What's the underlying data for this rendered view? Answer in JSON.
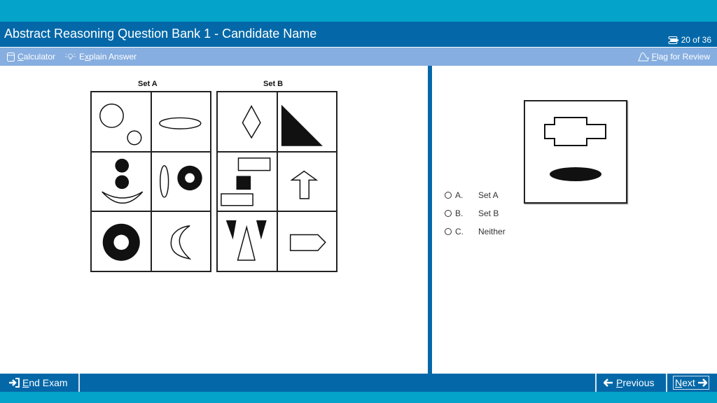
{
  "header": {
    "title": "Abstract Reasoning Question Bank 1 - Candidate Name",
    "counter": "20 of 36",
    "counter_icon": "question-list-icon"
  },
  "toolbar": {
    "calculator": {
      "label_u": "C",
      "label_rest": "alculator",
      "icon": "calculator-icon"
    },
    "explain": {
      "label_pre": "E",
      "label_u": "x",
      "label_rest": "plain Answer",
      "icon": "lightbulb-icon"
    },
    "flag": {
      "label_u": "F",
      "label_rest": "lag for Review",
      "icon": "flag-icon"
    }
  },
  "puzzle": {
    "set_a": {
      "label": "Set A",
      "cells": [
        "two-outline-circles",
        "horizontal-outline-ellipse",
        "two-black-dots-and-smile",
        "vertical-ellipse-and-black-ring",
        "large-black-ring",
        "crescent-moon"
      ]
    },
    "set_b": {
      "label": "Set B",
      "cells": [
        "outline-diamond",
        "black-right-triangle",
        "two-rectangles-and-black-square",
        "outline-up-arrow",
        "two-black-triangles-and-outline-triangle",
        "outline-pentagon-arrow"
      ]
    },
    "question_figure": [
      "outline-cross-shape",
      "black-ellipse"
    ]
  },
  "options": [
    {
      "letter": "A.",
      "text": "Set A",
      "selected": false
    },
    {
      "letter": "B.",
      "text": "Set B",
      "selected": false
    },
    {
      "letter": "C.",
      "text": "Neither",
      "selected": false
    }
  ],
  "footer": {
    "end_exam": {
      "label_u": "E",
      "label_rest": "nd Exam",
      "icon": "exit-icon"
    },
    "previous": {
      "label_u": "P",
      "label_rest": "revious",
      "icon": "arrow-left-icon"
    },
    "next": {
      "label_u": "N",
      "label_rest": "ext",
      "icon": "arrow-right-icon"
    }
  },
  "colors": {
    "frame": "#04a3c9",
    "primary": "#0468a8",
    "toolbar": "#86aee0"
  }
}
